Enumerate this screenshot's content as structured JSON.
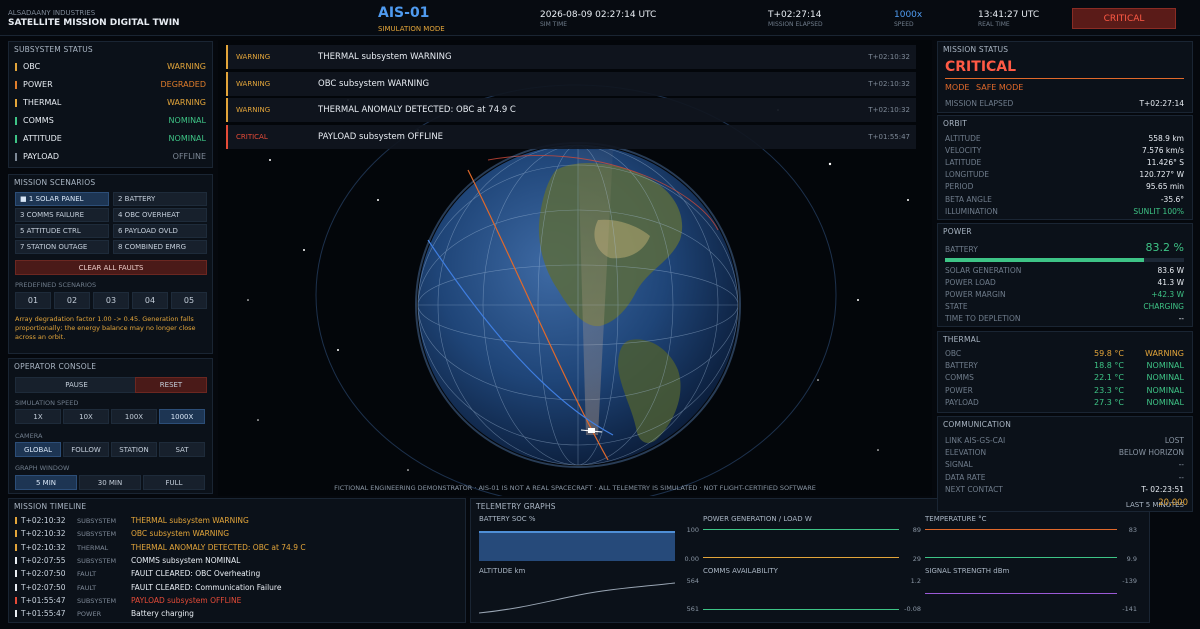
{
  "header": {
    "company": "ALSADAANY INDUSTRIES",
    "title": "SATELLITE MISSION DIGITAL TWIN",
    "sat_id": "AIS-01",
    "mode": "SIMULATION MODE",
    "sim_time": "2026-08-09 02:27:14 UTC",
    "sim_time_label": "SIM TIME",
    "elapsed": "T+02:27:14",
    "elapsed_label": "MISSION ELAPSED",
    "speed": "1000x",
    "speed_label": "SPEED",
    "real_time": "13:41:27 UTC",
    "real_time_label": "REAL TIME",
    "status": "CRITICAL"
  },
  "subsystems": {
    "title": "SUBSYSTEM STATUS",
    "items": [
      {
        "name": "OBC",
        "state": "WARNING",
        "color": "#e3a53a"
      },
      {
        "name": "POWER",
        "state": "DEGRADED",
        "color": "#e07d2b"
      },
      {
        "name": "THERMAL",
        "state": "WARNING",
        "color": "#e3a53a"
      },
      {
        "name": "COMMS",
        "state": "NOMINAL",
        "color": "#3ec486"
      },
      {
        "name": "ATTITUDE",
        "state": "NOMINAL",
        "color": "#3ec486"
      },
      {
        "name": "PAYLOAD",
        "state": "OFFLINE",
        "color": "#7d8896"
      }
    ]
  },
  "scenarios": {
    "title": "MISSION SCENARIOS",
    "items": [
      "■ 1 SOLAR PANEL",
      "2 BATTERY",
      "3 COMMS FAILURE",
      "4 OBC OVERHEAT",
      "5 ATTITUDE CTRL",
      "6 PAYLOAD OVLD",
      "7 STATION OUTAGE",
      "8 COMBINED EMRG"
    ],
    "clear": "CLEAR ALL FAULTS",
    "predefined_label": "PREDEFINED SCENARIOS",
    "predefined": [
      "01",
      "02",
      "03",
      "04",
      "05"
    ],
    "note": "Array degradation factor 1.00 -> 0.45. Generation falls proportionally; the energy balance may no longer close across an orbit."
  },
  "console": {
    "title": "OPERATOR CONSOLE",
    "pause": "PAUSE",
    "reset": "RESET",
    "speed_label": "SIMULATION SPEED",
    "speeds": [
      "1X",
      "10X",
      "100X",
      "1000X"
    ],
    "camera_label": "CAMERA",
    "cameras": [
      "GLOBAL",
      "FOLLOW",
      "STATION",
      "SAT"
    ],
    "window_label": "GRAPH WINDOW",
    "windows": [
      "5 MIN",
      "30 MIN",
      "FULL"
    ]
  },
  "alerts": [
    {
      "level": "WARNING",
      "msg": "THERMAL subsystem WARNING",
      "time": "T+02:10:32",
      "color": "#e3a53a"
    },
    {
      "level": "WARNING",
      "msg": "OBC subsystem WARNING",
      "time": "T+02:10:32",
      "color": "#e3a53a"
    },
    {
      "level": "WARNING",
      "msg": "THERMAL ANOMALY DETECTED: OBC at 74.9 C",
      "time": "T+02:10:32",
      "color": "#e3a53a"
    },
    {
      "level": "CRITICAL",
      "msg": "PAYLOAD subsystem OFFLINE",
      "time": "T+01:55:47",
      "color": "#e54b38"
    }
  ],
  "disclaimer": "FICTIONAL ENGINEERING DEMONSTRATOR  ·  AIS-01 IS NOT A REAL SPACECRAFT  ·  ALL TELEMETRY IS SIMULATED  ·  NOT FLIGHT-CERTIFIED SOFTWARE",
  "timeline": {
    "title": "MISSION TIMELINE",
    "items": [
      {
        "time": "T+02:10:32",
        "cat": "SUBSYSTEM",
        "msg": "THERMAL subsystem WARNING",
        "color": "#e3a53a"
      },
      {
        "time": "T+02:10:32",
        "cat": "SUBSYSTEM",
        "msg": "OBC subsystem WARNING",
        "color": "#e3a53a"
      },
      {
        "time": "T+02:10:32",
        "cat": "THERMAL",
        "msg": "THERMAL ANOMALY DETECTED: OBC at 74.9 C",
        "color": "#e3a53a"
      },
      {
        "time": "T+02:07:55",
        "cat": "SUBSYSTEM",
        "msg": "COMMS subsystem NOMINAL",
        "color": "#e8edf3"
      },
      {
        "time": "T+02:07:50",
        "cat": "FAULT",
        "msg": "FAULT CLEARED: OBC Overheating",
        "color": "#e8edf3"
      },
      {
        "time": "T+02:07:50",
        "cat": "FAULT",
        "msg": "FAULT CLEARED: Communication Failure",
        "color": "#e8edf3"
      },
      {
        "time": "T+01:55:47",
        "cat": "SUBSYSTEM",
        "msg": "PAYLOAD subsystem OFFLINE",
        "color": "#e54b38"
      },
      {
        "time": "T+01:55:47",
        "cat": "POWER",
        "msg": "Battery charging",
        "color": "#e8edf3"
      }
    ]
  },
  "telemetry": {
    "title": "TELEMETRY GRAPHS",
    "battery": {
      "label": "BATTERY SOC  %",
      "max": "100",
      "min": "0.00"
    },
    "power": {
      "label": "POWER  GENERATION / LOAD  W",
      "max": "89",
      "min": "29"
    },
    "temp": {
      "label": "TEMPERATURE  °C",
      "max": "83",
      "min": "9.9"
    },
    "alt": {
      "label": "ALTITUDE  km",
      "max": "564",
      "min": "561"
    },
    "comms": {
      "label": "COMMS AVAILABILITY",
      "max": "1.2",
      "min": "-0.08"
    },
    "signal": {
      "label": "SIGNAL STRENGTH  dBm",
      "max": "-139",
      "min": "-141"
    }
  },
  "mission_status": {
    "title": "MISSION STATUS",
    "status": "CRITICAL",
    "mode_label": "MODE",
    "mode": "SAFE MODE",
    "elapsed_label": "MISSION ELAPSED",
    "elapsed": "T+02:27:14"
  },
  "orbit": {
    "title": "ORBIT",
    "rows": [
      {
        "k": "ALTITUDE",
        "v": "558.9 km"
      },
      {
        "k": "VELOCITY",
        "v": "7.576 km/s"
      },
      {
        "k": "LATITUDE",
        "v": "11.426° S"
      },
      {
        "k": "LONGITUDE",
        "v": "120.727° W"
      },
      {
        "k": "PERIOD",
        "v": "95.65 min"
      },
      {
        "k": "BETA ANGLE",
        "v": "-35.6°"
      }
    ],
    "illum_label": "ILLUMINATION",
    "illum": "SUNLIT  100%"
  },
  "power": {
    "title": "POWER",
    "battery_label": "BATTERY",
    "battery": "83.2 %",
    "battery_level": 0.832,
    "rows": [
      {
        "k": "SOLAR GENERATION",
        "v": "83.6 W"
      },
      {
        "k": "POWER LOAD",
        "v": "41.3 W"
      },
      {
        "k": "POWER MARGIN",
        "v": "+42.3 W"
      },
      {
        "k": "STATE",
        "v": "CHARGING"
      },
      {
        "k": "TIME TO DEPLETION",
        "v": "--"
      }
    ]
  },
  "thermal": {
    "title": "THERMAL",
    "rows": [
      {
        "k": "OBC",
        "t": "59.8 °C",
        "s": "WARNING",
        "color": "#e3a53a"
      },
      {
        "k": "BATTERY",
        "t": "18.8 °C",
        "s": "NOMINAL",
        "color": "#3ec486"
      },
      {
        "k": "COMMS",
        "t": "22.1 °C",
        "s": "NOMINAL",
        "color": "#3ec486"
      },
      {
        "k": "POWER",
        "t": "23.3 °C",
        "s": "NOMINAL",
        "color": "#3ec486"
      },
      {
        "k": "PAYLOAD",
        "t": "27.3 °C",
        "s": "NOMINAL",
        "color": "#3ec486"
      }
    ]
  },
  "comms": {
    "title": "COMMUNICATION",
    "rows": [
      {
        "k": "LINK  AIS-GS-CAI",
        "v": "LOST"
      },
      {
        "k": "ELEVATION",
        "v": "BELOW HORIZON"
      },
      {
        "k": "SIGNAL",
        "v": "--"
      },
      {
        "k": "DATA RATE",
        "v": "--"
      },
      {
        "k": "NEXT CONTACT",
        "v": "T- 02:23:51"
      }
    ],
    "window_label": "LAST 5 MINUTES",
    "window_value": "20,000"
  }
}
